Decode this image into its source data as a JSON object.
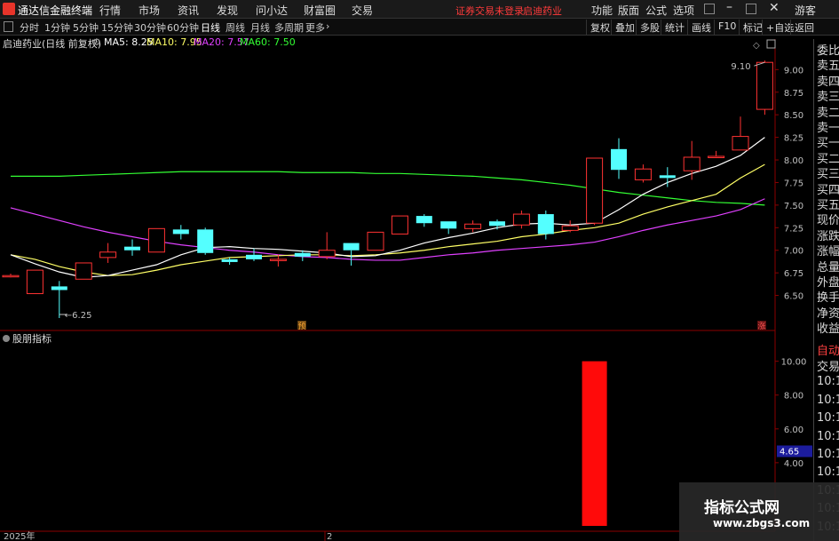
{
  "app": {
    "title": "通达信金融终端",
    "warning": "证券交易未登录",
    "stock_name": "启迪药业",
    "guest": "游客"
  },
  "menu": [
    "行情",
    "市场",
    "资讯",
    "发现",
    "问小达",
    "财富圈",
    "交易"
  ],
  "menu_right": [
    "功能",
    "版面",
    "公式",
    "选项"
  ],
  "periods": [
    "分时",
    "1分钟",
    "5分钟",
    "15分钟",
    "30分钟",
    "60分钟",
    "日线",
    "周线",
    "月线",
    "多周期",
    "更多"
  ],
  "active_period": "日线",
  "toolbar_right": [
    "复权",
    "叠加",
    "多股",
    "统计",
    "画线",
    "F10",
    "标记",
    "+自选",
    "返回"
  ],
  "legend": {
    "title": "启迪药业(日线 前复权)",
    "ma5": "MA5: 8.25",
    "ma10": "MA10: 7.95",
    "ma20": "MA20: 7.57",
    "ma60": "MA60: 7.50",
    "colors": {
      "ma5": "#ffffff",
      "ma10": "#ffff66",
      "ma20": "#e040ff",
      "ma60": "#33ff33"
    }
  },
  "price_axis": [
    "9.00",
    "8.75",
    "8.50",
    "8.25",
    "8.00",
    "7.75",
    "7.50",
    "7.25",
    "7.00",
    "6.75",
    "6.50"
  ],
  "price_labels": {
    "high": "9.10",
    "low": "6.25"
  },
  "markers": {
    "yu": "预",
    "zhang": "涨"
  },
  "indicator": {
    "name": "股朋指标",
    "axis": [
      "10.00",
      "8.00",
      "6.00",
      "4.00"
    ],
    "current": "4.65"
  },
  "right_panel": {
    "top": [
      "委比",
      "卖五",
      "卖四",
      "卖三",
      "卖二",
      "卖一",
      "买一",
      "买二",
      "买三",
      "买四",
      "买五",
      "现价",
      "涨跌",
      "涨幅",
      "总量",
      "外盘",
      "换手",
      "净资",
      "收益"
    ],
    "bottom_red": [
      "自动"
    ],
    "bottom": [
      "交易",
      "10:11",
      "10:11",
      "10:11",
      "10:11",
      "10:11",
      "10:11",
      "10:11",
      "10:11",
      "10:11"
    ]
  },
  "date_axis": {
    "year": "2025年",
    "month": "2"
  },
  "watermark": {
    "line1": "指标公式网",
    "line2": "www.zbgs3.com"
  },
  "chart_data": {
    "type": "candlestick",
    "ylim": [
      6.25,
      9.2
    ],
    "candles": [
      {
        "o": 6.72,
        "h": 6.74,
        "l": 6.7,
        "c": 6.72
      },
      {
        "o": 6.52,
        "h": 6.78,
        "l": 6.52,
        "c": 6.78
      },
      {
        "o": 6.6,
        "h": 6.66,
        "l": 6.25,
        "c": 6.56
      },
      {
        "o": 6.68,
        "h": 6.86,
        "l": 6.68,
        "c": 6.86
      },
      {
        "o": 6.92,
        "h": 7.08,
        "l": 6.86,
        "c": 6.98
      },
      {
        "o": 7.04,
        "h": 7.12,
        "l": 6.94,
        "c": 7.0
      },
      {
        "o": 6.98,
        "h": 7.24,
        "l": 6.98,
        "c": 7.24
      },
      {
        "o": 7.23,
        "h": 7.28,
        "l": 7.12,
        "c": 7.18
      },
      {
        "o": 7.23,
        "h": 7.25,
        "l": 6.95,
        "c": 6.97
      },
      {
        "o": 6.9,
        "h": 6.92,
        "l": 6.84,
        "c": 6.87
      },
      {
        "o": 6.95,
        "h": 7.02,
        "l": 6.88,
        "c": 6.9
      },
      {
        "o": 6.9,
        "h": 6.95,
        "l": 6.82,
        "c": 6.9
      },
      {
        "o": 6.97,
        "h": 7.0,
        "l": 6.88,
        "c": 6.93
      },
      {
        "o": 6.93,
        "h": 7.2,
        "l": 6.9,
        "c": 7.0
      },
      {
        "o": 7.08,
        "h": 7.08,
        "l": 6.83,
        "c": 7.0
      },
      {
        "o": 7.0,
        "h": 7.2,
        "l": 7.0,
        "c": 7.2
      },
      {
        "o": 7.18,
        "h": 7.38,
        "l": 7.18,
        "c": 7.38
      },
      {
        "o": 7.38,
        "h": 7.4,
        "l": 7.26,
        "c": 7.3
      },
      {
        "o": 7.32,
        "h": 7.32,
        "l": 7.18,
        "c": 7.24
      },
      {
        "o": 7.24,
        "h": 7.33,
        "l": 7.2,
        "c": 7.29
      },
      {
        "o": 7.32,
        "h": 7.34,
        "l": 7.23,
        "c": 7.27
      },
      {
        "o": 7.28,
        "h": 7.44,
        "l": 7.24,
        "c": 7.4
      },
      {
        "o": 7.4,
        "h": 7.44,
        "l": 7.12,
        "c": 7.18
      },
      {
        "o": 7.22,
        "h": 7.33,
        "l": 7.2,
        "c": 7.27
      },
      {
        "o": 7.3,
        "h": 8.02,
        "l": 7.28,
        "c": 8.02
      },
      {
        "o": 8.12,
        "h": 8.24,
        "l": 7.79,
        "c": 7.89
      },
      {
        "o": 7.78,
        "h": 7.95,
        "l": 7.75,
        "c": 7.9
      },
      {
        "o": 7.83,
        "h": 7.92,
        "l": 7.7,
        "c": 7.8
      },
      {
        "o": 7.88,
        "h": 8.21,
        "l": 7.78,
        "c": 8.03
      },
      {
        "o": 8.04,
        "h": 8.1,
        "l": 8.02,
        "c": 8.04
      },
      {
        "o": 8.11,
        "h": 8.48,
        "l": 8.11,
        "c": 8.26
      },
      {
        "o": 8.56,
        "h": 9.1,
        "l": 8.5,
        "c": 9.08
      }
    ],
    "ma5": [
      6.95,
      6.85,
      6.76,
      6.7,
      6.72,
      6.78,
      6.84,
      6.95,
      7.03,
      7.04,
      7.02,
      7.01,
      6.99,
      6.97,
      6.93,
      6.94,
      7.0,
      7.08,
      7.14,
      7.19,
      7.25,
      7.29,
      7.3,
      7.28,
      7.3,
      7.45,
      7.62,
      7.75,
      7.85,
      7.93,
      8.05,
      8.25
    ],
    "ma10": [
      6.95,
      6.9,
      6.82,
      6.76,
      6.72,
      6.73,
      6.78,
      6.84,
      6.88,
      6.92,
      6.93,
      6.94,
      6.95,
      6.95,
      6.94,
      6.95,
      6.97,
      7.0,
      7.04,
      7.07,
      7.1,
      7.15,
      7.18,
      7.22,
      7.25,
      7.3,
      7.4,
      7.48,
      7.55,
      7.62,
      7.8,
      7.95
    ],
    "ma20": [
      7.47,
      7.4,
      7.33,
      7.26,
      7.2,
      7.15,
      7.1,
      7.06,
      7.03,
      7.0,
      6.98,
      6.95,
      6.93,
      6.92,
      6.9,
      6.89,
      6.89,
      6.92,
      6.95,
      6.97,
      7.0,
      7.02,
      7.04,
      7.06,
      7.09,
      7.15,
      7.22,
      7.28,
      7.33,
      7.38,
      7.45,
      7.57
    ],
    "ma60": [
      7.82,
      7.82,
      7.82,
      7.83,
      7.84,
      7.85,
      7.86,
      7.87,
      7.87,
      7.87,
      7.87,
      7.87,
      7.86,
      7.86,
      7.86,
      7.85,
      7.85,
      7.84,
      7.83,
      7.82,
      7.8,
      7.78,
      7.75,
      7.72,
      7.68,
      7.64,
      7.61,
      7.58,
      7.55,
      7.53,
      7.52,
      7.5
    ],
    "indicator_bars": [
      {
        "index": 24,
        "value": 10.0
      }
    ]
  }
}
